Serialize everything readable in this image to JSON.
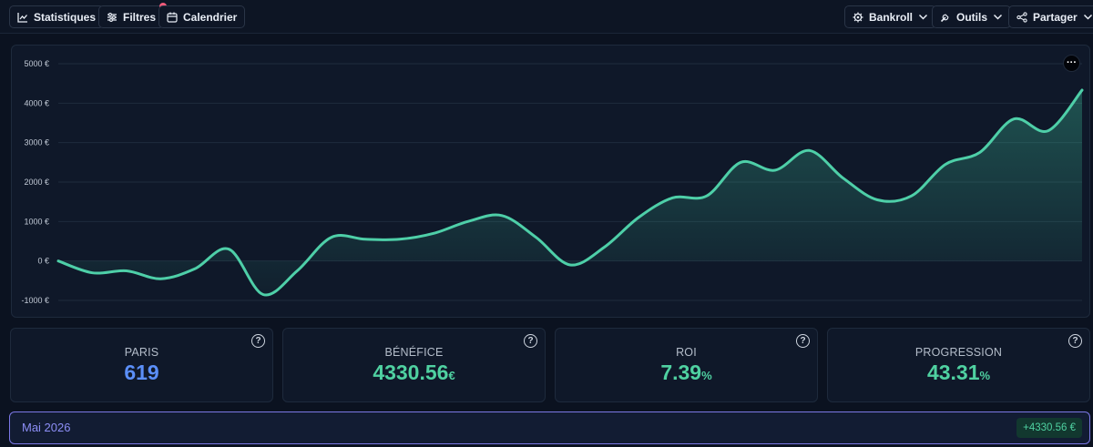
{
  "toolbar": {
    "left": [
      {
        "label": "Statistiques",
        "icon": "line-chart-icon"
      },
      {
        "label": "Filtres",
        "icon": "sliders-icon",
        "has_notification_dot": true
      },
      {
        "label": "Calendrier",
        "icon": "calendar-icon"
      }
    ],
    "right": [
      {
        "label": "Bankroll",
        "icon": "gear-icon"
      },
      {
        "label": "Outils",
        "icon": "wrench-icon"
      },
      {
        "label": "Partager",
        "icon": "share-icon"
      }
    ]
  },
  "chart_data": {
    "type": "area",
    "title": "",
    "xlabel": "",
    "ylabel": "",
    "ylim": [
      -1000,
      5000
    ],
    "y_ticks": [
      "5000 €",
      "4000 €",
      "3000 €",
      "2000 €",
      "1000 €",
      "0 €",
      "-1000 €"
    ],
    "y_tick_values": [
      5000,
      4000,
      3000,
      2000,
      1000,
      0,
      -1000
    ],
    "grid": true,
    "legend": "none",
    "series": [
      {
        "x": [
          0,
          2,
          4,
          6,
          8,
          10,
          12,
          14,
          16,
          18,
          20,
          22,
          24,
          26,
          28,
          30,
          32,
          34,
          36,
          38,
          40,
          42,
          44,
          46,
          48,
          50,
          52,
          54,
          56,
          58,
          60,
          62,
          64,
          66,
          68,
          70,
          72,
          74,
          76,
          78,
          80,
          82,
          84,
          86,
          88,
          90,
          92,
          94,
          96,
          98,
          100
        ],
        "values": [
          0,
          -300,
          -250,
          -450,
          -200,
          300,
          -850,
          -250,
          600,
          550,
          550,
          700,
          1000,
          1150,
          600,
          -100,
          350,
          1100,
          1600,
          1650,
          2500,
          2300,
          2800,
          2100,
          1550,
          1650,
          2450,
          2750,
          3600,
          3300,
          4330,
          null,
          null,
          null,
          null,
          null,
          null,
          null,
          null,
          null,
          null,
          null,
          null,
          null,
          null,
          null,
          null,
          null,
          null,
          null,
          null
        ],
        "color": "#4ecfa8"
      }
    ]
  },
  "stats": [
    {
      "label": "PARIS",
      "value": "619",
      "unit": "",
      "color": "#5b8ff9"
    },
    {
      "label": "BÉNÉFICE",
      "value": "4330.56",
      "unit": "€",
      "color": "#4fd1a1"
    },
    {
      "label": "ROI",
      "value": "7.39",
      "unit": "%",
      "color": "#4fd1a1"
    },
    {
      "label": "PROGRESSION",
      "value": "43.31",
      "unit": "%",
      "color": "#4fd1a1"
    }
  ],
  "month": {
    "name": "Mai 2026",
    "total": "+4330.56 €"
  },
  "more_button_label": "···",
  "help_label": "?"
}
